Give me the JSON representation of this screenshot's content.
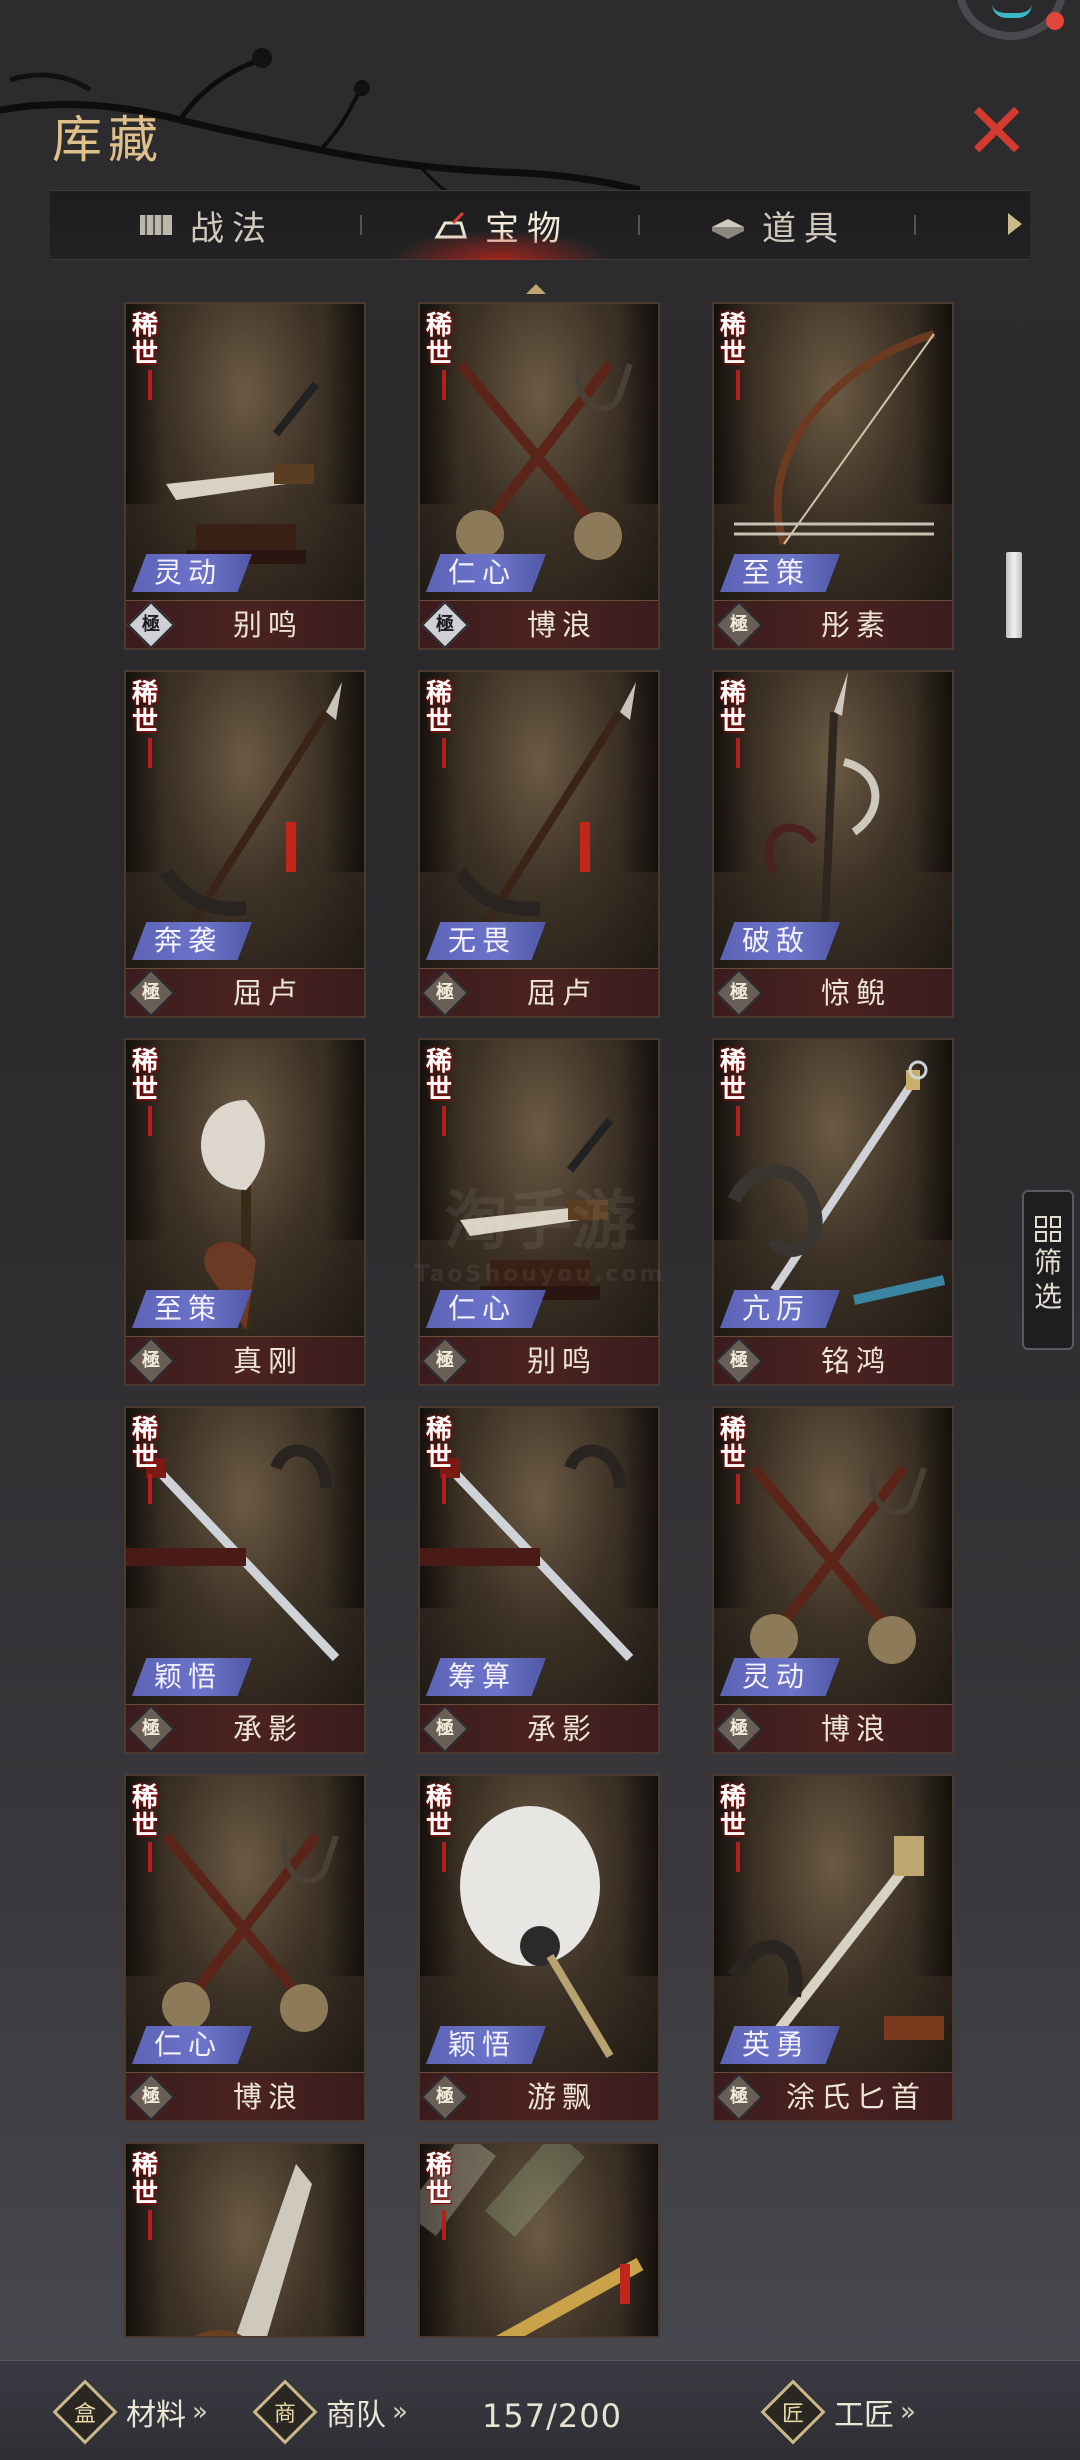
{
  "header": {
    "title": "库藏",
    "close_icon": "close-icon"
  },
  "tabs": [
    {
      "label": "战法",
      "icon": "scroll-icon",
      "active": false
    },
    {
      "label": "宝物",
      "icon": "treasure-icon",
      "active": true
    },
    {
      "label": "道具",
      "icon": "item-icon",
      "active": false
    }
  ],
  "cards": [
    {
      "rarity": "稀世",
      "trait": "灵动",
      "grade": "極",
      "name": "别鸣",
      "weapon": "dagger"
    },
    {
      "rarity": "稀世",
      "trait": "仁心",
      "grade": "極",
      "name": "博浪",
      "weapon": "maces"
    },
    {
      "rarity": "稀世",
      "trait": "至策",
      "grade": "極",
      "name": "彤素",
      "weapon": "bow"
    },
    {
      "rarity": "稀世",
      "trait": "奔袭",
      "grade": "極",
      "name": "屈卢",
      "weapon": "spear"
    },
    {
      "rarity": "稀世",
      "trait": "无畏",
      "grade": "極",
      "name": "屈卢",
      "weapon": "spear"
    },
    {
      "rarity": "稀世",
      "trait": "破敌",
      "grade": "極",
      "name": "惊鲵",
      "weapon": "halberd"
    },
    {
      "rarity": "稀世",
      "trait": "至策",
      "grade": "極",
      "name": "真刚",
      "weapon": "axe"
    },
    {
      "rarity": "稀世",
      "trait": "仁心",
      "grade": "極",
      "name": "别鸣",
      "weapon": "dagger"
    },
    {
      "rarity": "稀世",
      "trait": "亢厉",
      "grade": "極",
      "name": "铭鸿",
      "weapon": "sword"
    },
    {
      "rarity": "稀世",
      "trait": "颖悟",
      "grade": "極",
      "name": "承影",
      "weapon": "sword2"
    },
    {
      "rarity": "稀世",
      "trait": "筹算",
      "grade": "極",
      "name": "承影",
      "weapon": "sword2"
    },
    {
      "rarity": "稀世",
      "trait": "灵动",
      "grade": "極",
      "name": "博浪",
      "weapon": "maces"
    },
    {
      "rarity": "稀世",
      "trait": "仁心",
      "grade": "極",
      "name": "博浪",
      "weapon": "maces"
    },
    {
      "rarity": "稀世",
      "trait": "颖悟",
      "grade": "極",
      "name": "游飘",
      "weapon": "fan"
    },
    {
      "rarity": "稀世",
      "trait": "英勇",
      "grade": "極",
      "name": "涂氏匕首",
      "weapon": "knife"
    },
    {
      "rarity": "稀世",
      "trait": "",
      "grade": "",
      "name": "",
      "weapon": "blade"
    },
    {
      "rarity": "稀世",
      "trait": "",
      "grade": "",
      "name": "",
      "weapon": "scepter"
    }
  ],
  "filter": {
    "label": "筛选",
    "icon": "grid-icon"
  },
  "watermark": {
    "text": "淘手游",
    "sub": "TaoShouyou.com"
  },
  "bottom": {
    "materials": "材料",
    "materials_icon_char": "盒",
    "caravan": "商队",
    "caravan_icon_char": "商",
    "count": "157/200",
    "craftsman": "工匠",
    "craftsman_icon_char": "匠",
    "chevron": "»"
  }
}
